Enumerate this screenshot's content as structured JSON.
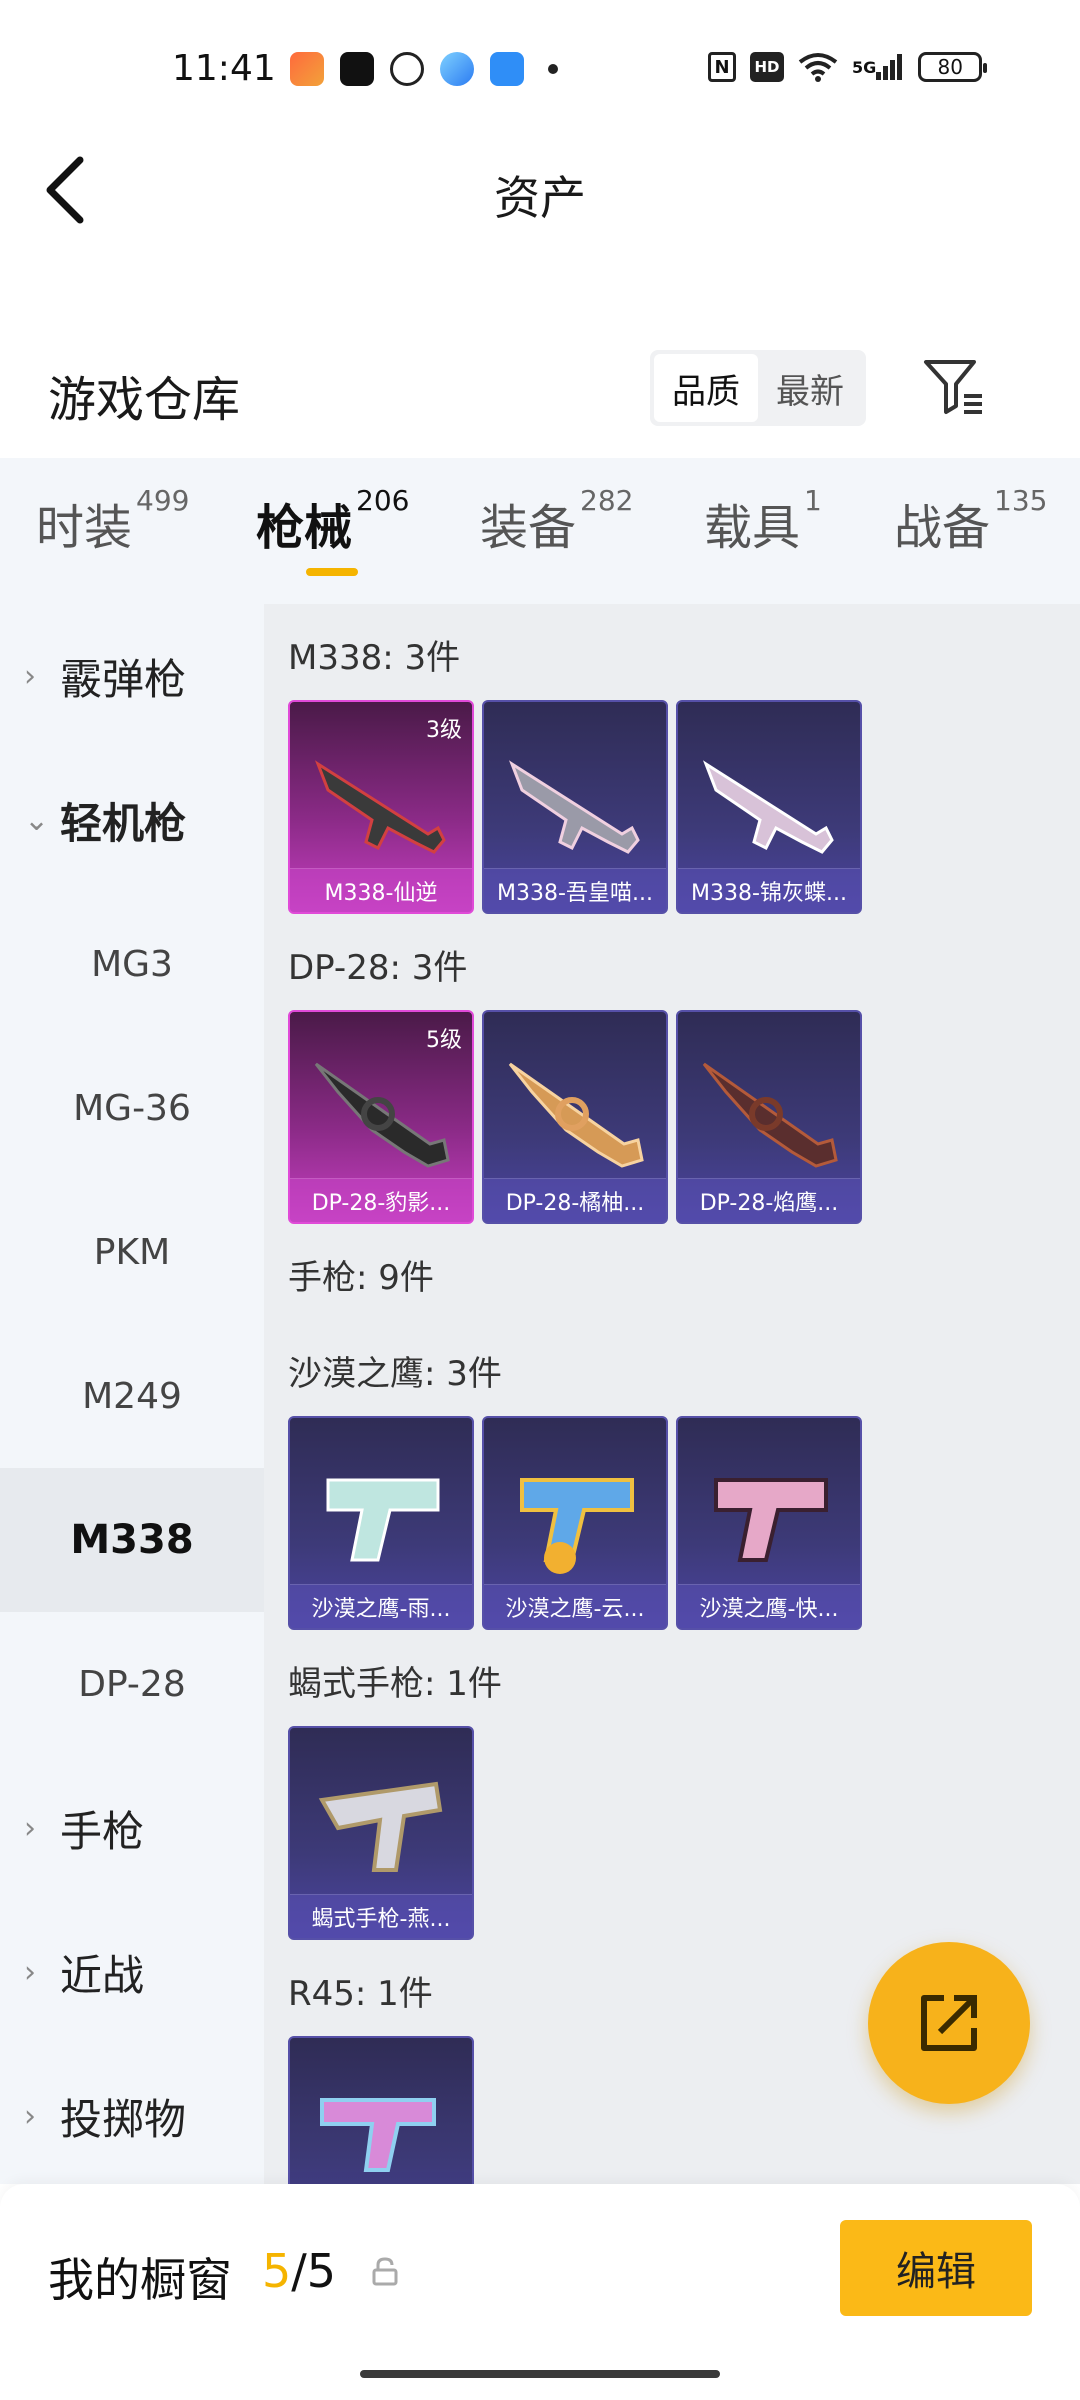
{
  "status_bar": {
    "time": "11:41",
    "apps": [
      "game-app-icon",
      "tiktok-icon",
      "wechat-icon",
      "browser-icon",
      "files-icon"
    ],
    "nfc": "N",
    "hd": "HD",
    "signal": "5G",
    "battery": "80"
  },
  "nav": {
    "title": "资产"
  },
  "warehouse": {
    "title": "游戏仓库",
    "sort_options": [
      "品质",
      "最新"
    ],
    "active_sort": "品质"
  },
  "tabs": [
    {
      "label": "时装",
      "count": "499"
    },
    {
      "label": "枪械",
      "count": "206"
    },
    {
      "label": "装备",
      "count": "282"
    },
    {
      "label": "载具",
      "count": "1"
    },
    {
      "label": "战备",
      "count": "135"
    }
  ],
  "sidebar": {
    "items": [
      {
        "label": "霰弹枪",
        "type": "category",
        "chevron": ">"
      },
      {
        "label": "轻机枪",
        "type": "category",
        "chevron": "v"
      },
      {
        "label": "MG3",
        "type": "sub"
      },
      {
        "label": "MG-36",
        "type": "sub"
      },
      {
        "label": "PKM",
        "type": "sub"
      },
      {
        "label": "M249",
        "type": "sub"
      },
      {
        "label": "M338",
        "type": "sub",
        "selected": true
      },
      {
        "label": "DP-28",
        "type": "sub"
      },
      {
        "label": "手枪",
        "type": "category",
        "chevron": ">"
      },
      {
        "label": "近战",
        "type": "category",
        "chevron": ">"
      },
      {
        "label": "投掷物",
        "type": "category",
        "chevron": ">"
      }
    ]
  },
  "groups": [
    {
      "title": "M338: 3件",
      "cards": [
        {
          "name": "M338-仙逆",
          "level": "3级",
          "tier": "gold"
        },
        {
          "name": "M338-吾皇喵...",
          "tier": "purple"
        },
        {
          "name": "M338-锦灰蝶...",
          "tier": "purple"
        }
      ]
    },
    {
      "title": "DP-28: 3件",
      "cards": [
        {
          "name": "DP-28-豹影...",
          "level": "5级",
          "tier": "gold"
        },
        {
          "name": "DP-28-橘柚...",
          "tier": "purple"
        },
        {
          "name": "DP-28-焰鹰...",
          "tier": "purple"
        }
      ]
    },
    {
      "title": "手枪: 9件",
      "cards": []
    },
    {
      "title": "沙漠之鹰: 3件",
      "cards": [
        {
          "name": "沙漠之鹰-雨...",
          "tier": "purple"
        },
        {
          "name": "沙漠之鹰-云...",
          "tier": "purple"
        },
        {
          "name": "沙漠之鹰-快...",
          "tier": "purple"
        }
      ]
    },
    {
      "title": "蝎式手枪: 1件",
      "cards": [
        {
          "name": "蝎式手枪-燕...",
          "tier": "purple"
        }
      ]
    },
    {
      "title": "R45: 1件",
      "cards": [
        {
          "name": "",
          "tier": "purple"
        }
      ]
    }
  ],
  "bottom_bar": {
    "label": "我的橱窗",
    "count_current": "5",
    "count_sep": "/",
    "count_total": "5",
    "edit_label": "编辑"
  },
  "colors": {
    "accent": "#f5b400",
    "gold_card": "#c53fc0",
    "purple_card": "#4b44a0"
  }
}
